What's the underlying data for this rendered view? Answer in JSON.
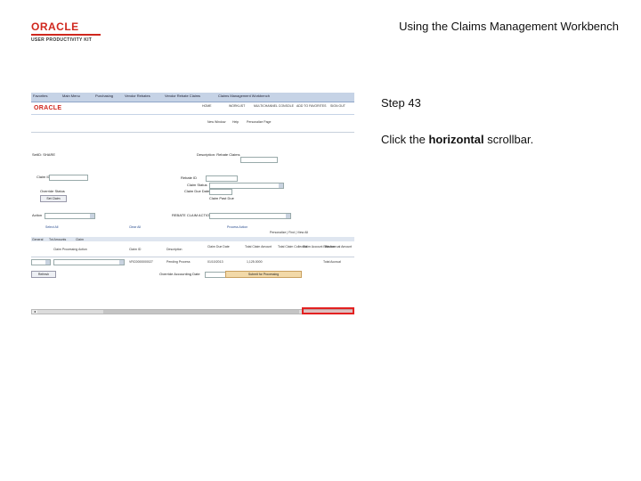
{
  "header": {
    "logo_brand": "ORACLE",
    "logo_subtitle": "USER PRODUCTIVITY KIT",
    "page_title": "Using the Claims Management Workbench"
  },
  "step": {
    "label": "Step 43",
    "instruction_prefix": "Click the ",
    "instruction_bold": "horizontal",
    "instruction_suffix": " scrollbar."
  },
  "screenshot": {
    "tabs": [
      "Favorites",
      "Main Menu",
      "Purchasing",
      "Vendor Rebates",
      "Vendor Rebate Claims",
      "Claims Management Workbench"
    ],
    "top_links": [
      "HOME",
      "WORKLIST",
      "MULTICHANNEL CONSOLE",
      "ADD TO FAVORITES",
      "SIGN OUT"
    ],
    "oracle": "ORACLE",
    "util_links": [
      "New Window",
      "Help",
      "Personalize Page"
    ],
    "labels": {
      "setid": "SetID: SHARE",
      "claim": "Claim ID:",
      "description": "Description: Rebate Claims",
      "rebate_id": "Rebate ID",
      "claim_status": "Claim Status",
      "claim_due_date": "Claim Due Date",
      "override_status": "Override Status",
      "set_claim": "Set Claim",
      "claim_past_due": "Claim Past Due",
      "action": "Action",
      "rebate_claim_action": "REBATE CLAIM ACTION",
      "select_all": "Select All",
      "clear_all": "Clear All",
      "process_action": "Process Action",
      "personalize_find": "Personalize | Find | View All",
      "override_acct_date": "Override Accounting Date",
      "submit_processing": "Submit for Processing",
      "refresh": "Refresh"
    },
    "grid_tabs": [
      "General",
      "Tot Amounts",
      "Claim"
    ],
    "grid_headers": [
      "Claim Processing Action",
      "Claim ID",
      "Description",
      "Claim Due Date",
      "Total Claim Amount",
      "Total Claim Collected",
      "Claim Account Balance",
      "Re-Accrual Amount"
    ],
    "grid_row": [
      "",
      "VRC0000000027",
      "Pending Process",
      "01/10/2013",
      "1,125.0000",
      "",
      "",
      "Total Accrual"
    ]
  },
  "colors": {
    "highlight": "#e32121",
    "oracle_red": "#d0271d"
  }
}
